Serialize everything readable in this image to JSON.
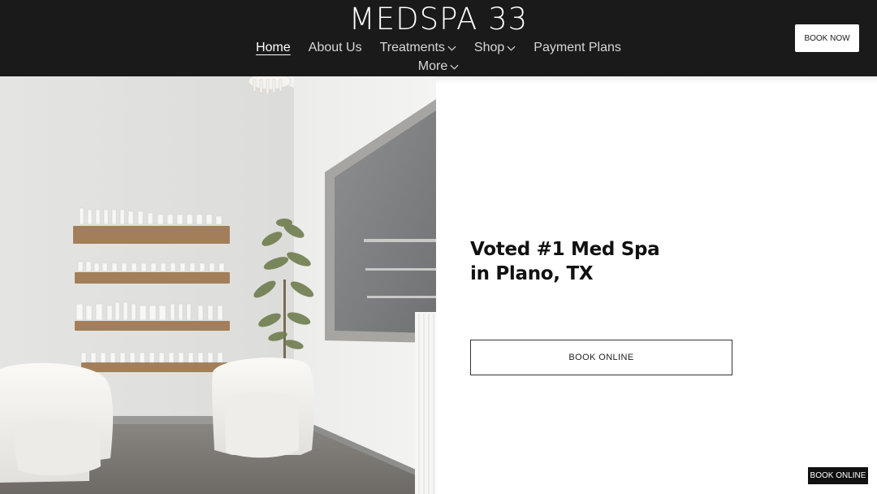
{
  "header": {
    "brand": "MEDSPA 33",
    "book_now_label": "BOOK NOW",
    "nav": [
      {
        "label": "Home",
        "active": true
      },
      {
        "label": "About Us"
      },
      {
        "label": "Treatments",
        "icon": "chevron-down-icon"
      },
      {
        "label": "Shop",
        "icon": "chevron-down-icon"
      },
      {
        "label": "Payment Plans"
      }
    ],
    "more": {
      "label": "More",
      "icon": "chevron-down-icon"
    }
  },
  "hero": {
    "headline_line1": "Voted #1 Med Spa",
    "headline_line2": "in Plano, TX",
    "cta_label": "BOOK ONLINE"
  },
  "floating": {
    "label": "BOOK ONLINE"
  },
  "colors": {
    "header_bg": "#1a1a1a",
    "text_dark": "#111111",
    "white": "#ffffff"
  }
}
